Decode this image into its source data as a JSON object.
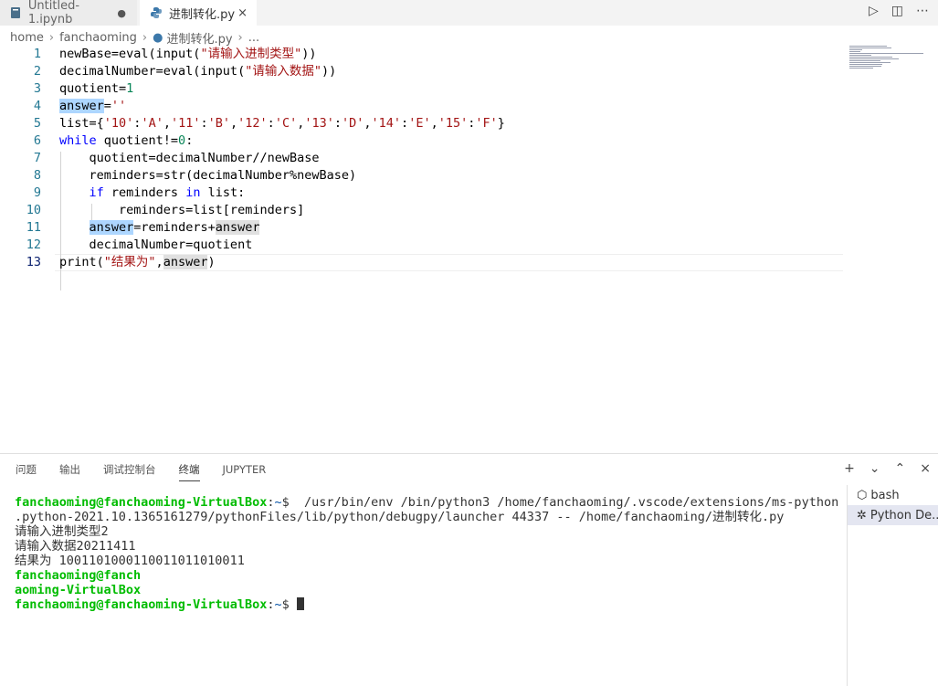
{
  "tabs": [
    {
      "label": "Untitled-1.ipynb",
      "icon": "notebook-icon",
      "dirty_mark": "●"
    },
    {
      "label": "进制转化.py",
      "icon": "python-icon",
      "close_mark": "×"
    }
  ],
  "title_actions": {
    "run": "▷",
    "split": "◫",
    "more": "⋯"
  },
  "breadcrumb": {
    "items": [
      "home",
      "fanchaoming",
      "进制转化.py",
      "..."
    ]
  },
  "editor": {
    "line_numbers": [
      "1",
      "2",
      "3",
      "4",
      "5",
      "6",
      "7",
      "8",
      "9",
      "10",
      "11",
      "12",
      "13"
    ],
    "lines": [
      [
        {
          "t": "newBase=eval(input("
        },
        {
          "t": "\"请输入进制类型\"",
          "c": "str"
        },
        {
          "t": "))"
        }
      ],
      [
        {
          "t": "decimalNumber=eval(input("
        },
        {
          "t": "\"请输入数据\"",
          "c": "str"
        },
        {
          "t": "))"
        }
      ],
      [
        {
          "t": "quotient="
        },
        {
          "t": "1",
          "c": "num"
        }
      ],
      [
        {
          "t": "answer",
          "c": "hl-blue"
        },
        {
          "t": "="
        },
        {
          "t": "''",
          "c": "str"
        }
      ],
      [
        {
          "t": "list={"
        },
        {
          "t": "'10'",
          "c": "str"
        },
        {
          "t": ":"
        },
        {
          "t": "'A'",
          "c": "str"
        },
        {
          "t": ","
        },
        {
          "t": "'11'",
          "c": "str"
        },
        {
          "t": ":"
        },
        {
          "t": "'B'",
          "c": "str"
        },
        {
          "t": ","
        },
        {
          "t": "'12'",
          "c": "str"
        },
        {
          "t": ":"
        },
        {
          "t": "'C'",
          "c": "str"
        },
        {
          "t": ","
        },
        {
          "t": "'13'",
          "c": "str"
        },
        {
          "t": ":"
        },
        {
          "t": "'D'",
          "c": "str"
        },
        {
          "t": ","
        },
        {
          "t": "'14'",
          "c": "str"
        },
        {
          "t": ":"
        },
        {
          "t": "'E'",
          "c": "str"
        },
        {
          "t": ","
        },
        {
          "t": "'15'",
          "c": "str"
        },
        {
          "t": ":"
        },
        {
          "t": "'F'",
          "c": "str"
        },
        {
          "t": "}"
        }
      ],
      [
        {
          "t": "while",
          "c": "kw"
        },
        {
          "t": " quotient!="
        },
        {
          "t": "0",
          "c": "num"
        },
        {
          "t": ":"
        }
      ],
      [
        {
          "t": "    quotient=decimalNumber//newBase"
        }
      ],
      [
        {
          "t": "    reminders=str(decimalNumber%newBase)"
        }
      ],
      [
        {
          "t": "    "
        },
        {
          "t": "if",
          "c": "kw"
        },
        {
          "t": " reminders "
        },
        {
          "t": "in",
          "c": "kw"
        },
        {
          "t": " list:"
        }
      ],
      [
        {
          "t": "        reminders=list[reminders]"
        }
      ],
      [
        {
          "t": "    "
        },
        {
          "t": "answer",
          "c": "hl-blue"
        },
        {
          "t": "=reminders+"
        },
        {
          "t": "answer",
          "c": "hl-gray"
        }
      ],
      [
        {
          "t": "    decimalNumber=quotient"
        }
      ],
      [
        {
          "t": "print("
        },
        {
          "t": "\"结果为\"",
          "c": "str"
        },
        {
          "t": ","
        },
        {
          "t": "answer",
          "c": "hl-gray"
        },
        {
          "t": ")"
        }
      ]
    ]
  },
  "panel": {
    "tabs": [
      "问题",
      "输出",
      "调试控制台",
      "终端",
      "JUPYTER"
    ],
    "active_tab": "终端",
    "actions": {
      "add": "+",
      "add_menu": "⌄",
      "maximize": "⌃",
      "close": "×"
    },
    "terminal_lines": [
      [
        {
          "t": "fanchaoming@fanchaoming-VirtualBox",
          "c": "prompt"
        },
        {
          "t": ":"
        },
        {
          "t": "~",
          "c": "path"
        },
        {
          "t": "$  /usr/bin/env /bin/python3 /home/fanchaoming/.vscode/extensions/ms-python"
        }
      ],
      [
        {
          "t": ".python-2021.10.1365161279/pythonFiles/lib/python/debugpy/launcher 44337 -- /home/fanchaoming/进制转化.py"
        }
      ],
      [
        {
          "t": "请输入进制类型2"
        }
      ],
      [
        {
          "t": "请输入数据20211411"
        }
      ],
      [
        {
          "t": "结果为 1001101000110011011010011"
        }
      ],
      [
        {
          "t": "fanchaoming@fanch",
          "c": "prompt"
        }
      ],
      [
        {
          "t": "aoming-VirtualBox",
          "c": "prompt"
        }
      ],
      [
        {
          "t": "fanchaoming@fanchaoming-VirtualBox",
          "c": "prompt"
        },
        {
          "t": ":"
        },
        {
          "t": "~",
          "c": "path"
        },
        {
          "t": "$ "
        }
      ]
    ],
    "terminal_list": [
      {
        "label": "bash",
        "icon": "terminal-icon"
      },
      {
        "label": "Python De...",
        "icon": "debug-icon"
      }
    ]
  }
}
